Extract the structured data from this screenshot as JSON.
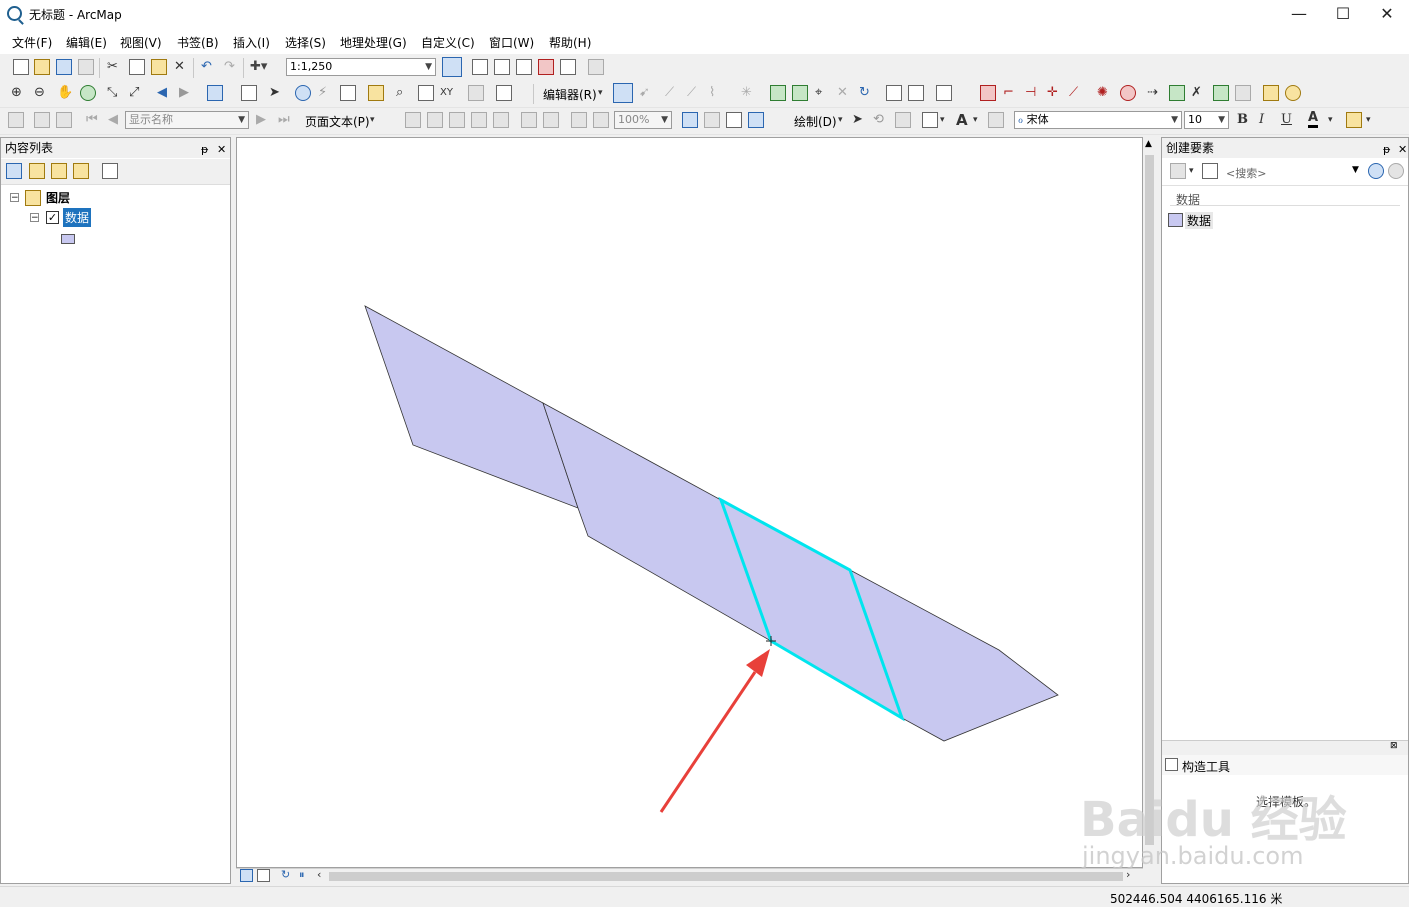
{
  "window": {
    "title": "无标题 - ArcMap",
    "minimize_glyph": "—",
    "maximize_glyph": "☐",
    "close_glyph": "✕"
  },
  "menu": [
    "文件(F)",
    "编辑(E)",
    "视图(V)",
    "书签(B)",
    "插入(I)",
    "选择(S)",
    "地理处理(G)",
    "自定义(C)",
    "窗口(W)",
    "帮助(H)"
  ],
  "toolbar": {
    "scale_value": "1:1,250",
    "display_name_combo": "显示名称",
    "editor_label": "编辑器(R)",
    "layout_text_label": "页面文本(P)",
    "zoom_value": "100%",
    "draw_label": "绘制(D)",
    "font_name": "宋体",
    "font_size": "10",
    "bold": "B",
    "italic": "I",
    "underline": "U",
    "font_color_glyph": "A"
  },
  "toc": {
    "title": "内容列表",
    "pin": "ᵽ",
    "close": "✕",
    "root_label": "图层",
    "layer_label": "数据",
    "expander_minus": "−",
    "check": "✓"
  },
  "create_features": {
    "title": "创建要素",
    "search_placeholder": "<搜索>",
    "group_label": "数据",
    "template_label": "数据",
    "construction_tools_title": "构造工具",
    "hint": "选择模板。"
  },
  "status": {
    "coordinates": "502446.504  4406165.116 米"
  },
  "watermark": {
    "brand": "Baidu 经验",
    "url": "jingyan.baidu.com"
  },
  "colors": {
    "polygon_fill": "#c8c8f0",
    "selection": "#00e5ee",
    "arrow": "#e8403a",
    "selected_label_bg": "#1e73be"
  }
}
